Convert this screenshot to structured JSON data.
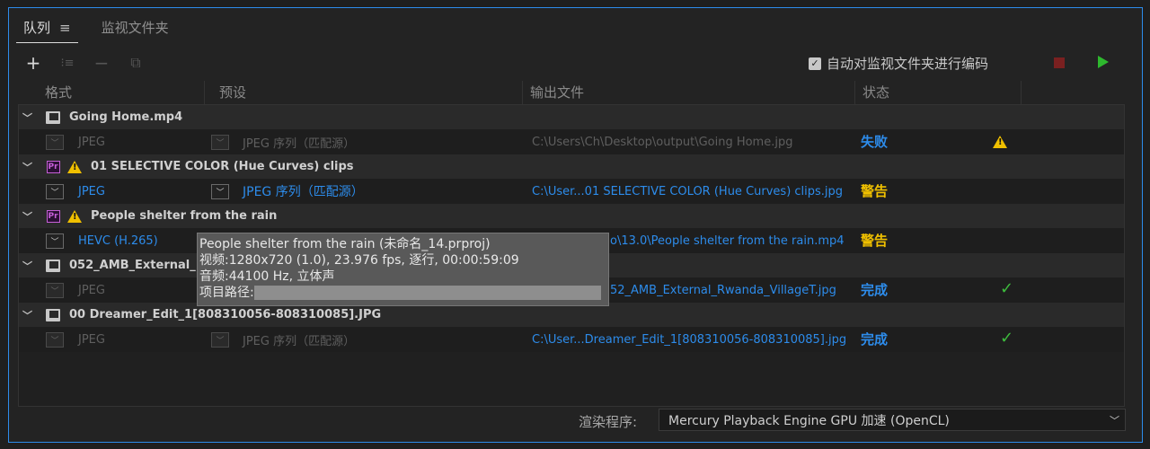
{
  "tabs": [
    {
      "label": "队列",
      "menu_glyph": "≡",
      "active": true
    },
    {
      "label": "监视文件夹",
      "active": false
    }
  ],
  "toolbar": {
    "add_glyph": "+",
    "settings_glyph": "⁝≡",
    "remove_glyph": "−",
    "duplicate_glyph": "⧉",
    "auto_encode_label": "自动对监视文件夹进行编码",
    "auto_encode_checked": true
  },
  "columns": {
    "format": "格式",
    "preset": "预设",
    "output": "输出文件",
    "status": "状态"
  },
  "groups": [
    {
      "name": "Going Home.mp4",
      "icon": "film-icon",
      "warning": false,
      "item": {
        "format": "JPEG",
        "preset": "JPEG 序列（匹配源）",
        "output": "C:\\Users\\Ch\\Desktop\\output\\Going Home.jpg",
        "status": "失败",
        "status_icon": "warning",
        "active": false
      }
    },
    {
      "name": "01 SELECTIVE COLOR (Hue Curves) clips",
      "icon": "premiere-icon",
      "warning": true,
      "item": {
        "format": "JPEG",
        "preset": "JPEG 序列（匹配源）",
        "output": "C:\\User...01 SELECTIVE COLOR (Hue Curves) clips.jpg",
        "status": "警告",
        "active": true
      }
    },
    {
      "name": "People shelter from the rain",
      "icon": "premiere-icon",
      "warning": true,
      "item": {
        "format": "HEVC (H.265)",
        "preset": "",
        "output": "o\\13.0\\People shelter from the rain.mp4",
        "status": "警告",
        "active": true
      }
    },
    {
      "name": "052_AMB_External_",
      "icon": "film-icon",
      "warning": false,
      "item": {
        "format": "JPEG",
        "preset": "",
        "output": "52_AMB_External_Rwanda_VillageT.jpg",
        "status": "完成",
        "status_icon": "check",
        "active": false
      }
    },
    {
      "name": "00 Dreamer_Edit_1[808310056-808310085].JPG",
      "icon": "film-icon",
      "warning": false,
      "item": {
        "format": "JPEG",
        "preset": "JPEG 序列（匹配源）",
        "output": "C:\\User...Dreamer_Edit_1[808310056-808310085].jpg",
        "status": "完成",
        "status_icon": "check",
        "active": false
      }
    }
  ],
  "tooltip": {
    "line1": "People shelter from the rain (未命名_14.prproj)",
    "line2": "视频:1280x720 (1.0), 23.976 fps, 逐行, 00:00:59:09",
    "line3": "音频:44100 Hz, 立体声",
    "line4_label": "项目路径:"
  },
  "renderer": {
    "label": "渲染程序:",
    "value": "Mercury Playback Engine GPU 加速 (OpenCL)"
  },
  "colors": {
    "accent_blue": "#2d8ceb",
    "warning_yellow": "#f0c000",
    "success_green": "#3dbb3d",
    "premiere_purple": "#c75fd8"
  }
}
